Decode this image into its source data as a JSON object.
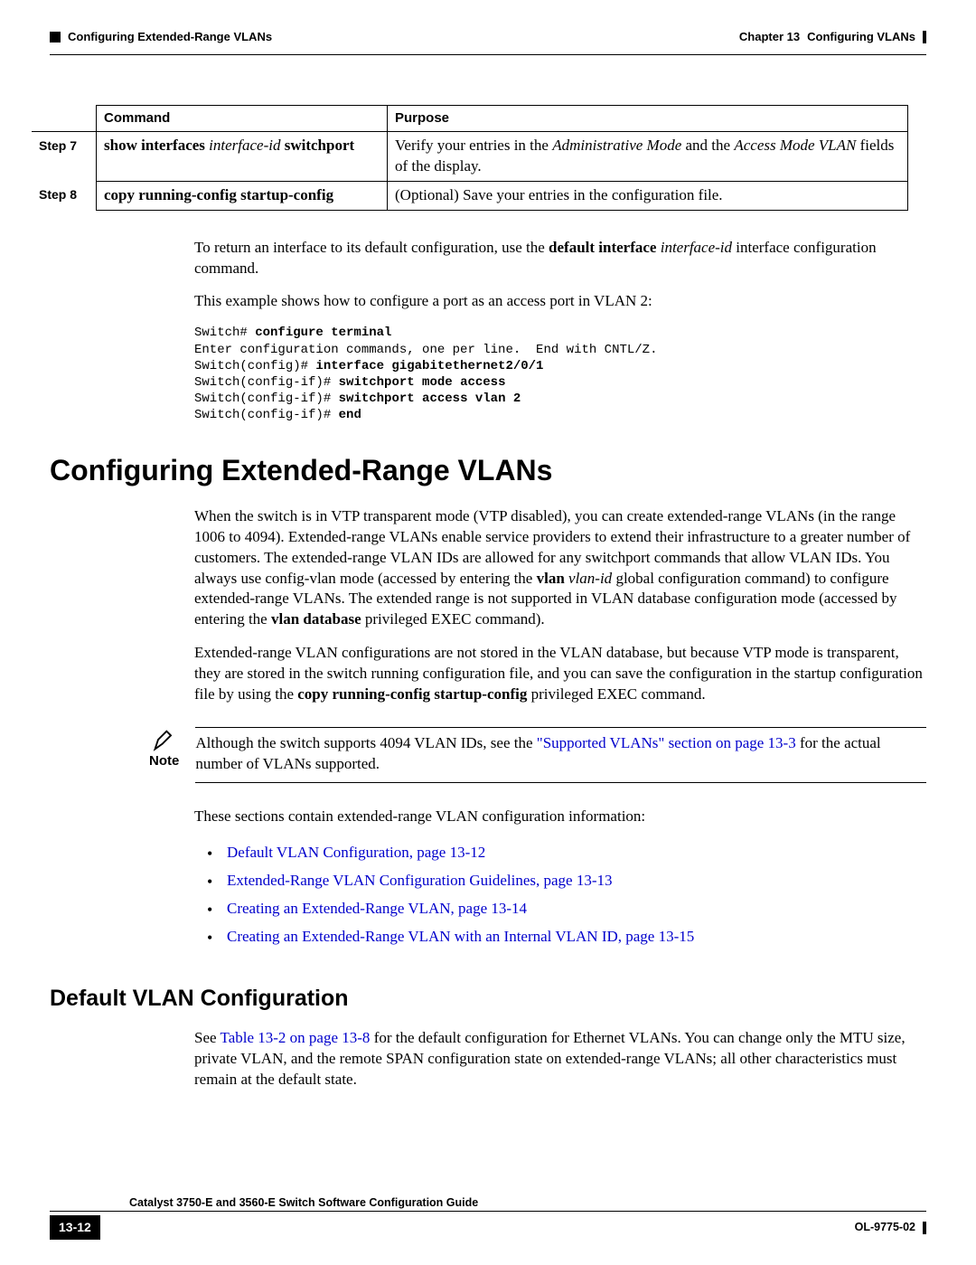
{
  "header": {
    "left_section": "Configuring Extended-Range VLANs",
    "right_chapter": "Chapter 13",
    "right_title": "Configuring VLANs"
  },
  "table": {
    "col1_header": "Command",
    "col2_header": "Purpose",
    "rows": [
      {
        "step": "Step 7",
        "cmd_b1": "show interfaces",
        "cmd_i": " interface-id ",
        "cmd_b2": "switchport",
        "purpose_pre": "Verify your entries in the ",
        "purpose_i1": "Administrative Mode",
        "purpose_mid": " and the ",
        "purpose_i2": "Access Mode VLAN",
        "purpose_post": " fields of the display."
      },
      {
        "step": "Step 8",
        "cmd_b1": "copy running-config startup-config",
        "purpose_pre": "(Optional) Save your entries in the configuration file."
      }
    ]
  },
  "body": {
    "p1_pre": "To return an interface to its default configuration, use the ",
    "p1_b": "default interface ",
    "p1_i": "interface-id ",
    "p1_post": "interface configuration command.",
    "p2": "This example shows how to configure a port as an access port in VLAN 2:",
    "code": {
      "l1a": "Switch# ",
      "l1b": "configure terminal",
      "l2": "Enter configuration commands, one per line.  End with CNTL/Z.",
      "l3a": "Switch(config)# ",
      "l3b": "interface gigabitethernet2/0/1",
      "l4a": "Switch(config-if)# ",
      "l4b": "switchport mode access",
      "l5a": "Switch(config-if)# ",
      "l5b": "switchport access vlan 2",
      "l6a": "Switch(config-if)# ",
      "l6b": "end"
    }
  },
  "h1": "Configuring Extended-Range VLANs",
  "sec1": {
    "p1a": "When the switch is in VTP transparent mode (VTP disabled), you can create extended-range VLANs (in the range 1006 to 4094). Extended-range VLANs enable service providers to extend their infrastructure to a greater number of customers. The extended-range VLAN IDs are allowed for any switchport commands that allow VLAN IDs. You always use config-vlan mode (accessed by entering the ",
    "p1b1": "vlan",
    "p1c": " ",
    "p1i": "vlan-id",
    "p1d": " global configuration command) to configure extended-range VLANs. The extended range is not supported in VLAN database configuration mode (accessed by entering the ",
    "p1b2": "vlan database",
    "p1e": " privileged EXEC command).",
    "p2a": "Extended-range VLAN configurations are not stored in the VLAN database, but because VTP mode is transparent, they are stored in the switch running configuration file, and you can save the configuration in the startup configuration file by using the ",
    "p2b": "copy running-config startup-config",
    "p2c": " privileged EXEC command."
  },
  "note": {
    "label": "Note",
    "t1": "Although the switch supports 4094 VLAN IDs, see the ",
    "t_link": "\"Supported VLANs\" section on page 13-3",
    "t2": " for the actual number of VLANs supported."
  },
  "intro_links": "These sections contain extended-range VLAN configuration information:",
  "links": [
    "Default VLAN Configuration, page 13-12",
    "Extended-Range VLAN Configuration Guidelines, page 13-13",
    "Creating an Extended-Range VLAN, page 13-14",
    "Creating an Extended-Range VLAN with an Internal VLAN ID, page 13-15"
  ],
  "h2": "Default VLAN Configuration",
  "sec2": {
    "t1": "See ",
    "t_link": "Table 13-2 on page 13-8",
    "t2": " for the default configuration for Ethernet VLANs. You can change only the MTU size, private VLAN, and the remote SPAN configuration state on extended-range VLANs; all other characteristics must remain at the default state."
  },
  "footer": {
    "guide_title": "Catalyst 3750-E and 3560-E Switch Software Configuration Guide",
    "page_num": "13-12",
    "doc_id": "OL-9775-02"
  }
}
